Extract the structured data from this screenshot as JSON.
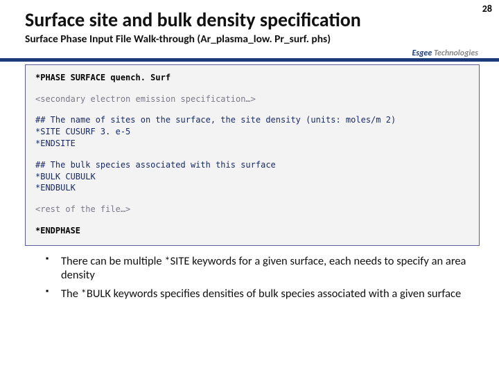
{
  "page_number": "28",
  "title": "Surface site and bulk density specification",
  "subtitle": "Surface Phase Input File Walk-through (Ar_plasma_low. Pr_surf. phs)",
  "logo": {
    "left": "Esgee",
    "right": "Technologies"
  },
  "code": {
    "header": "*PHASE SURFACE   quench. Surf",
    "secondary": "<secondary electron emission specification…>",
    "comment_sites": "##  The name of sites on the surface, the site density (units: moles/m 2)",
    "site_line": "*SITE CUSURF  3. e-5",
    "endsite": "*ENDSITE",
    "comment_bulk": "##  The bulk species associated with this surface",
    "bulk_line": "*BULK CUBULK",
    "endbulk": "*ENDBULK",
    "rest": "<rest of the file…>",
    "endphase": "*ENDPHASE"
  },
  "bullets": [
    "There can be multiple *SITE keywords for a given surface, each needs to specify an area density",
    "The *BULK keywords specifies densities of bulk species associated with a given surface"
  ]
}
